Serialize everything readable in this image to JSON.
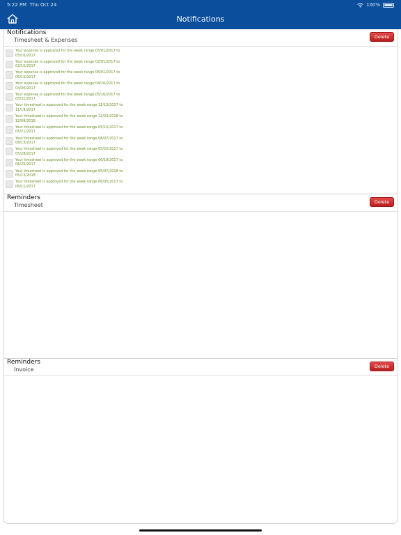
{
  "status_bar": {
    "time": "5:22 PM",
    "date": "Thu Oct 24",
    "battery": "100%"
  },
  "header": {
    "title": "Notifications"
  },
  "notifications_section": {
    "title": "Notifications",
    "subtitle": "Timesheet & Expenses",
    "delete_label": "Delete",
    "items": [
      {
        "text": "Your expense is approved for the week range 05/01/2017 to 05/10/2017"
      },
      {
        "text": "Your expense is approved for the week range 02/01/2017 to 02/15/2017"
      },
      {
        "text": "Your expense is approved for the week range 06/01/2017 to 06/15/2017"
      },
      {
        "text": "Your expense is approved for the week range 04/16/2017 to 04/30/2017"
      },
      {
        "text": "Your expense is approved for the week range 05/16/2017 to 05/31/2017"
      },
      {
        "text": "Your timesheet is approved for the week range 11/13/2017 to 11/19/2017"
      },
      {
        "text": "Your timesheet is approved for the week range 12/03/2018 to 12/09/2018"
      },
      {
        "text": "Your timesheet is approved for the week range 05/15/2017 to 05/21/2017"
      },
      {
        "text": "Your timesheet is approved for the week range 08/07/2017 to 08/13/2017"
      },
      {
        "text": "Your timesheet is approved for the week range 05/22/2017 to 05/28/2017"
      },
      {
        "text": "Your timesheet is approved for the week range 06/19/2017 to 06/25/2017"
      },
      {
        "text": "Your timesheet is approved for the week range 05/07/2018 to 05/13/2018"
      },
      {
        "text": "Your timesheet is approved for the week range 06/05/2017 to 06/11/2017"
      }
    ]
  },
  "reminders_timesheet": {
    "title": "Reminders",
    "subtitle": "Timesheet",
    "delete_label": "Delete"
  },
  "reminders_invoice": {
    "title": "Reminders",
    "subtitle": "Invoice",
    "delete_label": "Delete"
  },
  "colors": {
    "header_bg": "#0b4f9c",
    "notification_text": "#6a8f23",
    "delete_button": "#d22f2f"
  },
  "icons": {
    "home": "home-icon",
    "wifi": "wifi-icon",
    "battery": "battery-icon"
  }
}
